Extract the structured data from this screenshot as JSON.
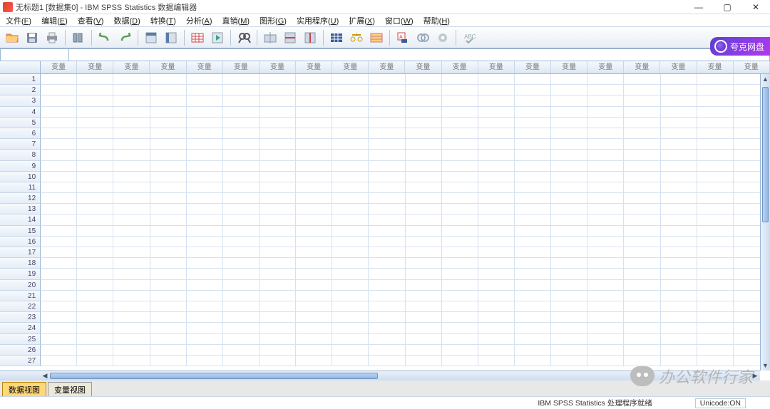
{
  "window": {
    "title": "无标题1 [数据集0] - IBM SPSS Statistics 数据编辑器"
  },
  "menus": [
    {
      "label": "文件",
      "key": "F"
    },
    {
      "label": "编辑",
      "key": "E"
    },
    {
      "label": "查看",
      "key": "V"
    },
    {
      "label": "数据",
      "key": "D"
    },
    {
      "label": "转换",
      "key": "T"
    },
    {
      "label": "分析",
      "key": "A"
    },
    {
      "label": "直销",
      "key": "M"
    },
    {
      "label": "图形",
      "key": "G"
    },
    {
      "label": "实用程序",
      "key": "U"
    },
    {
      "label": "扩展",
      "key": "X"
    },
    {
      "label": "窗口",
      "key": "W"
    },
    {
      "label": "帮助",
      "key": "H"
    }
  ],
  "column_header_label": "变量",
  "columns": 20,
  "rows": 27,
  "view_tabs": {
    "data_view": "数据视图",
    "variable_view": "变量视图"
  },
  "status": {
    "ready": "IBM SPSS Statistics 处理程序就绪",
    "unicode": "Unicode:ON"
  },
  "watermark": "办公软件行家",
  "quark_label": "夸克网盘"
}
